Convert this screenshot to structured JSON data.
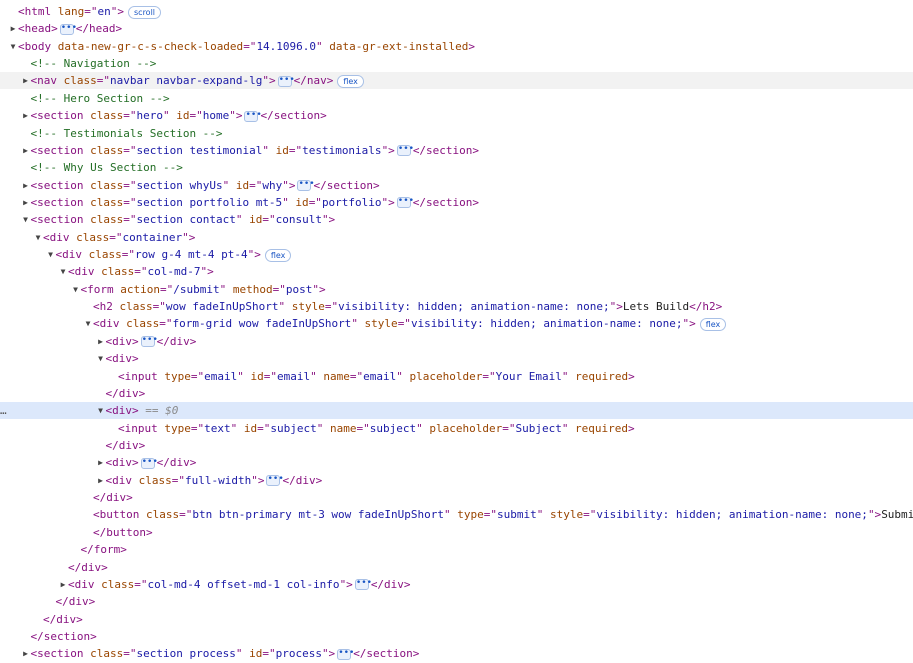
{
  "nodes": [
    {
      "indent": 0,
      "toggle": "none",
      "parts": [
        [
          "tag",
          "<html"
        ],
        [
          "an",
          " lang"
        ],
        [
          "tag",
          "=\""
        ],
        [
          "av",
          "en"
        ],
        [
          "tag",
          "\">"
        ]
      ],
      "badge": "scroll"
    },
    {
      "indent": 0,
      "toggle": "collapsed",
      "parts": [
        [
          "tag",
          "<head>"
        ],
        [
          "ell",
          ""
        ],
        [
          "tag",
          "</head>"
        ]
      ]
    },
    {
      "indent": 0,
      "toggle": "expanded",
      "parts": [
        [
          "tag",
          "<body"
        ],
        [
          "an",
          " data-new-gr-c-s-check-loaded"
        ],
        [
          "tag",
          "=\""
        ],
        [
          "av",
          "14.1096.0"
        ],
        [
          "tag",
          "\""
        ],
        [
          "an",
          " data-gr-ext-installed"
        ],
        [
          "tag",
          ">"
        ]
      ]
    },
    {
      "indent": 1,
      "toggle": "none",
      "parts": [
        [
          "cm",
          "<!-- Navigation -->"
        ]
      ]
    },
    {
      "indent": 1,
      "toggle": "collapsed",
      "hover": true,
      "parts": [
        [
          "tag",
          "<nav"
        ],
        [
          "an",
          " class"
        ],
        [
          "tag",
          "=\""
        ],
        [
          "av",
          "navbar navbar-expand-lg"
        ],
        [
          "tag",
          "\">"
        ],
        [
          "ell",
          ""
        ],
        [
          "tag",
          "</nav>"
        ]
      ],
      "badge": "flex"
    },
    {
      "indent": 1,
      "toggle": "none",
      "parts": [
        [
          "cm",
          "<!-- Hero Section -->"
        ]
      ]
    },
    {
      "indent": 1,
      "toggle": "collapsed",
      "parts": [
        [
          "tag",
          "<section"
        ],
        [
          "an",
          " class"
        ],
        [
          "tag",
          "=\""
        ],
        [
          "av",
          "hero"
        ],
        [
          "tag",
          "\""
        ],
        [
          "an",
          " id"
        ],
        [
          "tag",
          "=\""
        ],
        [
          "av",
          "home"
        ],
        [
          "tag",
          "\">"
        ],
        [
          "ell",
          ""
        ],
        [
          "tag",
          "</section>"
        ]
      ]
    },
    {
      "indent": 1,
      "toggle": "none",
      "parts": [
        [
          "cm",
          "<!-- Testimonials Section -->"
        ]
      ]
    },
    {
      "indent": 1,
      "toggle": "collapsed",
      "parts": [
        [
          "tag",
          "<section"
        ],
        [
          "an",
          " class"
        ],
        [
          "tag",
          "=\""
        ],
        [
          "av",
          "section testimonial"
        ],
        [
          "tag",
          "\""
        ],
        [
          "an",
          " id"
        ],
        [
          "tag",
          "=\""
        ],
        [
          "av",
          "testimonials"
        ],
        [
          "tag",
          "\">"
        ],
        [
          "ell",
          ""
        ],
        [
          "tag",
          "</section>"
        ]
      ]
    },
    {
      "indent": 1,
      "toggle": "none",
      "parts": [
        [
          "cm",
          "<!-- Why Us Section -->"
        ]
      ]
    },
    {
      "indent": 1,
      "toggle": "collapsed",
      "parts": [
        [
          "tag",
          "<section"
        ],
        [
          "an",
          " class"
        ],
        [
          "tag",
          "=\""
        ],
        [
          "av",
          "section whyUs"
        ],
        [
          "tag",
          "\""
        ],
        [
          "an",
          " id"
        ],
        [
          "tag",
          "=\""
        ],
        [
          "av",
          "why"
        ],
        [
          "tag",
          "\">"
        ],
        [
          "ell",
          ""
        ],
        [
          "tag",
          "</section>"
        ]
      ]
    },
    {
      "indent": 1,
      "toggle": "collapsed",
      "parts": [
        [
          "tag",
          "<section"
        ],
        [
          "an",
          " class"
        ],
        [
          "tag",
          "=\""
        ],
        [
          "av",
          "section portfolio mt-5"
        ],
        [
          "tag",
          "\""
        ],
        [
          "an",
          " id"
        ],
        [
          "tag",
          "=\""
        ],
        [
          "av",
          "portfolio"
        ],
        [
          "tag",
          "\">"
        ],
        [
          "ell",
          ""
        ],
        [
          "tag",
          "</section>"
        ]
      ]
    },
    {
      "indent": 1,
      "toggle": "expanded",
      "parts": [
        [
          "tag",
          "<section"
        ],
        [
          "an",
          " class"
        ],
        [
          "tag",
          "=\""
        ],
        [
          "av",
          "section contact"
        ],
        [
          "tag",
          "\""
        ],
        [
          "an",
          " id"
        ],
        [
          "tag",
          "=\""
        ],
        [
          "av",
          "consult"
        ],
        [
          "tag",
          "\">"
        ]
      ]
    },
    {
      "indent": 2,
      "toggle": "expanded",
      "parts": [
        [
          "tag",
          "<div"
        ],
        [
          "an",
          " class"
        ],
        [
          "tag",
          "=\""
        ],
        [
          "av",
          "container"
        ],
        [
          "tag",
          "\">"
        ]
      ]
    },
    {
      "indent": 3,
      "toggle": "expanded",
      "parts": [
        [
          "tag",
          "<div"
        ],
        [
          "an",
          " class"
        ],
        [
          "tag",
          "=\""
        ],
        [
          "av",
          "row g-4 mt-4 pt-4"
        ],
        [
          "tag",
          "\">"
        ]
      ],
      "badge": "flex"
    },
    {
      "indent": 4,
      "toggle": "expanded",
      "parts": [
        [
          "tag",
          "<div"
        ],
        [
          "an",
          " class"
        ],
        [
          "tag",
          "=\""
        ],
        [
          "av",
          "col-md-7"
        ],
        [
          "tag",
          "\">"
        ]
      ]
    },
    {
      "indent": 5,
      "toggle": "expanded",
      "parts": [
        [
          "tag",
          "<form"
        ],
        [
          "an",
          " action"
        ],
        [
          "tag",
          "=\""
        ],
        [
          "av",
          "/submit"
        ],
        [
          "tag",
          "\""
        ],
        [
          "an",
          " method"
        ],
        [
          "tag",
          "=\""
        ],
        [
          "av",
          "post"
        ],
        [
          "tag",
          "\">"
        ]
      ]
    },
    {
      "indent": 6,
      "toggle": "none",
      "parts": [
        [
          "tag",
          "<h2"
        ],
        [
          "an",
          " class"
        ],
        [
          "tag",
          "=\""
        ],
        [
          "av",
          "wow fadeInUpShort"
        ],
        [
          "tag",
          "\""
        ],
        [
          "an",
          " style"
        ],
        [
          "tag",
          "=\""
        ],
        [
          "av",
          "visibility: hidden; animation-name: none;"
        ],
        [
          "tag",
          "\">"
        ],
        [
          "tx",
          "Lets Build"
        ],
        [
          "tag",
          "</h2>"
        ]
      ]
    },
    {
      "indent": 6,
      "toggle": "expanded",
      "parts": [
        [
          "tag",
          "<div"
        ],
        [
          "an",
          " class"
        ],
        [
          "tag",
          "=\""
        ],
        [
          "av",
          "form-grid wow fadeInUpShort"
        ],
        [
          "tag",
          "\""
        ],
        [
          "an",
          " style"
        ],
        [
          "tag",
          "=\""
        ],
        [
          "av",
          "visibility: hidden; animation-name: none;"
        ],
        [
          "tag",
          "\">"
        ]
      ],
      "badge": "flex"
    },
    {
      "indent": 7,
      "toggle": "collapsed",
      "parts": [
        [
          "tag",
          "<div>"
        ],
        [
          "ell",
          ""
        ],
        [
          "tag",
          "</div>"
        ]
      ]
    },
    {
      "indent": 7,
      "toggle": "expanded",
      "parts": [
        [
          "tag",
          "<div>"
        ]
      ]
    },
    {
      "indent": 8,
      "toggle": "none",
      "parts": [
        [
          "tag",
          "<input"
        ],
        [
          "an",
          " type"
        ],
        [
          "tag",
          "=\""
        ],
        [
          "av",
          "email"
        ],
        [
          "tag",
          "\""
        ],
        [
          "an",
          " id"
        ],
        [
          "tag",
          "=\""
        ],
        [
          "av",
          "email"
        ],
        [
          "tag",
          "\""
        ],
        [
          "an",
          " name"
        ],
        [
          "tag",
          "=\""
        ],
        [
          "av",
          "email"
        ],
        [
          "tag",
          "\""
        ],
        [
          "an",
          " placeholder"
        ],
        [
          "tag",
          "=\""
        ],
        [
          "av",
          "Your Email"
        ],
        [
          "tag",
          "\""
        ],
        [
          "an",
          " required"
        ],
        [
          "tag",
          ">"
        ]
      ]
    },
    {
      "indent": 7,
      "toggle": "none",
      "parts": [
        [
          "tag",
          "</div>"
        ]
      ]
    },
    {
      "indent": 7,
      "toggle": "expanded",
      "selected": true,
      "parts": [
        [
          "tag",
          "<div>"
        ],
        [
          "eq",
          " == $0"
        ]
      ]
    },
    {
      "indent": 8,
      "toggle": "none",
      "parts": [
        [
          "tag",
          "<input"
        ],
        [
          "an",
          " type"
        ],
        [
          "tag",
          "=\""
        ],
        [
          "av",
          "text"
        ],
        [
          "tag",
          "\""
        ],
        [
          "an",
          " id"
        ],
        [
          "tag",
          "=\""
        ],
        [
          "av",
          "subject"
        ],
        [
          "tag",
          "\""
        ],
        [
          "an",
          " name"
        ],
        [
          "tag",
          "=\""
        ],
        [
          "av",
          "subject"
        ],
        [
          "tag",
          "\""
        ],
        [
          "an",
          " placeholder"
        ],
        [
          "tag",
          "=\""
        ],
        [
          "av",
          "Subject"
        ],
        [
          "tag",
          "\""
        ],
        [
          "an",
          " required"
        ],
        [
          "tag",
          ">"
        ]
      ]
    },
    {
      "indent": 7,
      "toggle": "none",
      "parts": [
        [
          "tag",
          "</div>"
        ]
      ]
    },
    {
      "indent": 7,
      "toggle": "collapsed",
      "parts": [
        [
          "tag",
          "<div>"
        ],
        [
          "ell",
          ""
        ],
        [
          "tag",
          "</div>"
        ]
      ]
    },
    {
      "indent": 7,
      "toggle": "collapsed",
      "parts": [
        [
          "tag",
          "<div"
        ],
        [
          "an",
          " class"
        ],
        [
          "tag",
          "=\""
        ],
        [
          "av",
          "full-width"
        ],
        [
          "tag",
          "\">"
        ],
        [
          "ell",
          ""
        ],
        [
          "tag",
          "</div>"
        ]
      ]
    },
    {
      "indent": 6,
      "toggle": "none",
      "parts": [
        [
          "tag",
          "</div>"
        ]
      ]
    },
    {
      "indent": 6,
      "toggle": "none",
      "parts": [
        [
          "tag",
          "<button"
        ],
        [
          "an",
          " class"
        ],
        [
          "tag",
          "=\""
        ],
        [
          "av",
          "btn btn-primary mt-3 wow fadeInUpShort"
        ],
        [
          "tag",
          "\""
        ],
        [
          "an",
          " type"
        ],
        [
          "tag",
          "=\""
        ],
        [
          "av",
          "submit"
        ],
        [
          "tag",
          "\""
        ],
        [
          "an",
          " style"
        ],
        [
          "tag",
          "=\""
        ],
        [
          "av",
          "visibility: hidden; animation-name: none;"
        ],
        [
          "tag",
          "\">"
        ],
        [
          "tx",
          "Submit"
        ]
      ]
    },
    {
      "indent": 6,
      "toggle": "none",
      "parts": [
        [
          "tag",
          "</button>"
        ]
      ]
    },
    {
      "indent": 5,
      "toggle": "none",
      "parts": [
        [
          "tag",
          "</form>"
        ]
      ]
    },
    {
      "indent": 4,
      "toggle": "none",
      "parts": [
        [
          "tag",
          "</div>"
        ]
      ]
    },
    {
      "indent": 4,
      "toggle": "collapsed",
      "parts": [
        [
          "tag",
          "<div"
        ],
        [
          "an",
          " class"
        ],
        [
          "tag",
          "=\""
        ],
        [
          "av",
          "col-md-4 offset-md-1 col-info"
        ],
        [
          "tag",
          "\">"
        ],
        [
          "ell",
          ""
        ],
        [
          "tag",
          "</div>"
        ]
      ]
    },
    {
      "indent": 3,
      "toggle": "none",
      "parts": [
        [
          "tag",
          "</div>"
        ]
      ]
    },
    {
      "indent": 2,
      "toggle": "none",
      "parts": [
        [
          "tag",
          "</div>"
        ]
      ]
    },
    {
      "indent": 1,
      "toggle": "none",
      "parts": [
        [
          "tag",
          "</section>"
        ]
      ]
    },
    {
      "indent": 1,
      "toggle": "collapsed",
      "parts": [
        [
          "tag",
          "<section"
        ],
        [
          "an",
          " class"
        ],
        [
          "tag",
          "=\""
        ],
        [
          "av",
          "section process"
        ],
        [
          "tag",
          "\""
        ],
        [
          "an",
          " id"
        ],
        [
          "tag",
          "=\""
        ],
        [
          "av",
          "process"
        ],
        [
          "tag",
          "\">"
        ],
        [
          "ell",
          ""
        ],
        [
          "tag",
          "</section>"
        ]
      ]
    }
  ],
  "gutter_marker": "…",
  "ellipsis_glyph": "•••",
  "colors": {
    "tag": "#881280",
    "attribute_name": "#994500",
    "attribute_value": "#1a1aa6",
    "comment": "#236e25",
    "selected_row": "#dce8fb",
    "badge": "#1a56c4"
  },
  "icons": {
    "expanded": "triangle-down-icon",
    "collapsed": "triangle-right-icon",
    "children_hidden": "ellipsis-icon"
  }
}
